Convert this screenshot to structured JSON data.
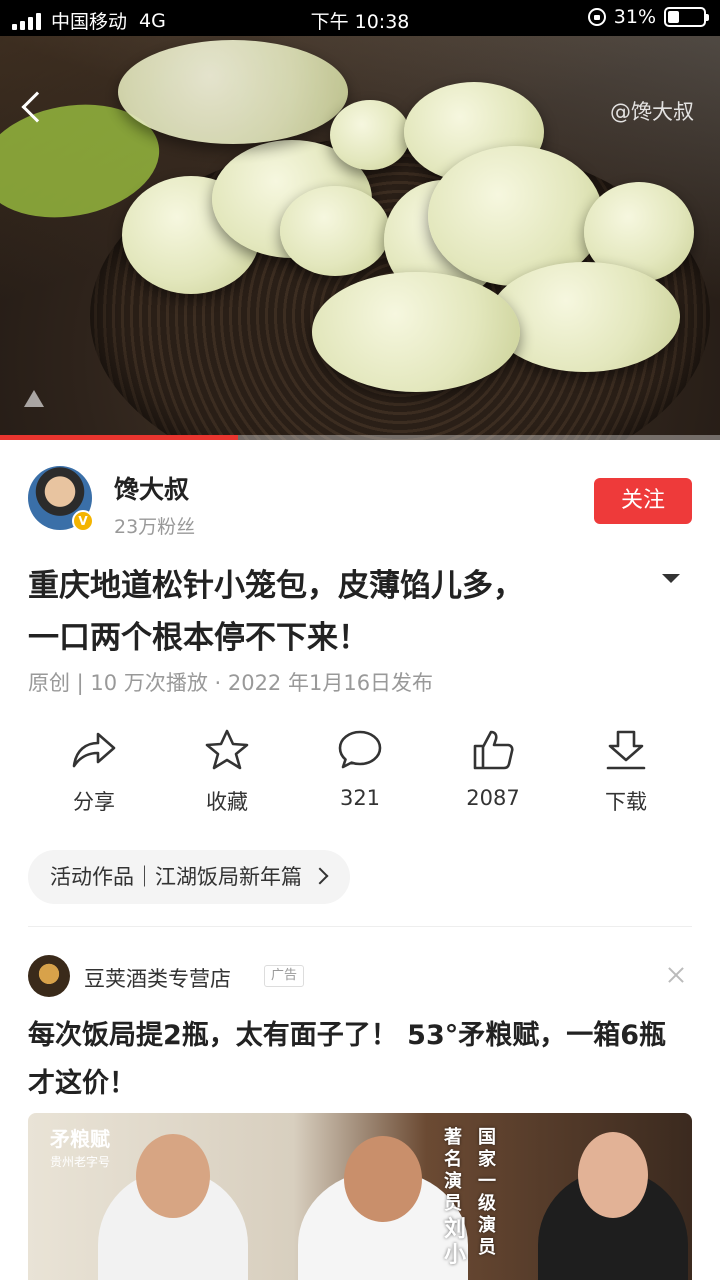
{
  "status_bar": {
    "carrier": "中国移动",
    "network": "4G",
    "time": "下午 10:38",
    "battery_percent": "31%",
    "battery_level": 0.31
  },
  "video": {
    "watermark": "@馋大叔",
    "progress": 0.33
  },
  "author": {
    "name": "馋大叔",
    "fans": "23万粉丝",
    "follow_label": "关注"
  },
  "post": {
    "title_line1": "重庆地道松针小笼包，皮薄馅儿多，",
    "title_line2": "一口两个根本停不下来！",
    "meta": "原创 | 10 万次播放 · 2022 年1月16日发布"
  },
  "actions": [
    {
      "label": "分享",
      "icon": "share-icon"
    },
    {
      "label": "收藏",
      "icon": "star-icon"
    },
    {
      "label": "321",
      "icon": "comment-icon"
    },
    {
      "label": "2087",
      "icon": "thumbs-up-icon"
    },
    {
      "label": "下载",
      "icon": "download-icon"
    }
  ],
  "activity_chip": {
    "label": "活动作品｜江湖饭局新年篇"
  },
  "ad": {
    "store_name": "豆荚酒类专营店",
    "tag": "广告",
    "title": "每次饭局提2瓶，太有面子了！ 53°矛粮赋，一箱6瓶才这价！",
    "brand": "矛粮赋",
    "brand_sub": "贵州老字号",
    "overlay_text_1": "著名演员",
    "overlay_text_2": "国家一级演员",
    "overlay_text_3": "刘小"
  },
  "colors": {
    "accent_red": "#ee3a3a",
    "progress_red": "#e9352f",
    "text_primary": "#222222",
    "text_secondary": "#999999"
  }
}
